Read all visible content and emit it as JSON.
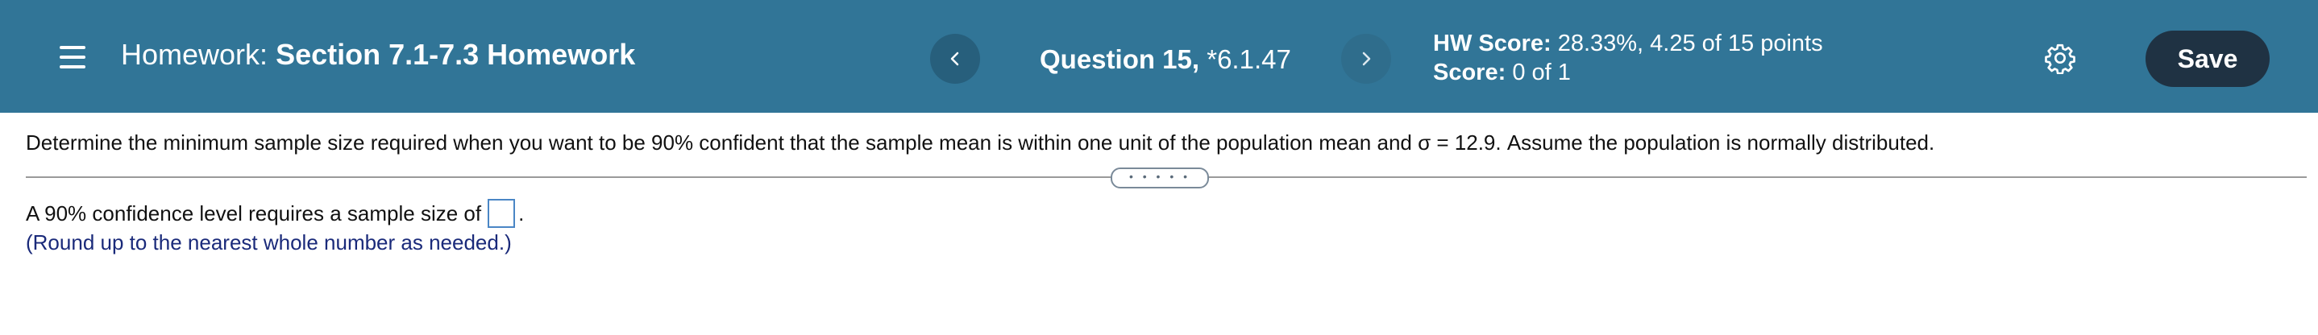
{
  "header": {
    "title_prefix": "Homework:",
    "title_name": "Section 7.1-7.3 Homework",
    "question_label": "Question 15,",
    "question_id": "*6.1.47",
    "hw_score_label": "HW Score:",
    "hw_score_value": "28.33%, 4.25 of 15 points",
    "score_label": "Score:",
    "score_value": "0 of 1",
    "save_label": "Save",
    "icons": [
      "menu-icon",
      "chevron-left-icon",
      "chevron-right-icon",
      "gear-icon"
    ],
    "colors": {
      "bar": "#317597",
      "save": "#1f3243"
    }
  },
  "question": {
    "text": "Determine the minimum sample size required when you want to be 90% confident that the sample mean is within one unit of the population mean and σ = 12.9. Assume the population is normally distributed.",
    "expand_dots": "• • • • •",
    "answer_prefix": "A 90% confidence level requires a sample size of",
    "answer_value": "",
    "answer_suffix": ".",
    "hint": "(Round up to the nearest whole number as needed.)"
  }
}
